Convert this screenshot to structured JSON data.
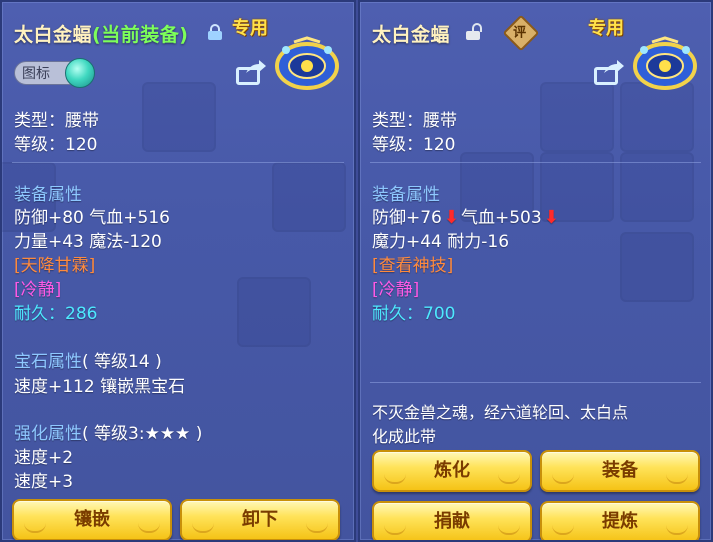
{
  "left": {
    "title_name": "太白金蝠",
    "title_status": "(当前装备)",
    "special_label": "专用",
    "toggle_label": "图标",
    "type_line": "类型：腰带",
    "level_line": "等级：120",
    "equip_attr_header": "装备属性",
    "stat_line_1": "防御+80 气血+516",
    "stat_line_2": "力量+43 魔法-120",
    "skill_tag": "[天降甘霖]",
    "effect_tag": "[冷静]",
    "durability_label": "耐久：",
    "durability_value": "286",
    "gem_header": "宝石属性",
    "gem_level": "( 等级14 )",
    "gem_line": "速度+112 镶嵌黑宝石",
    "enhance_header": "强化属性",
    "enhance_level": "( 等级3:★★★ )",
    "enhance_line_1": "速度+2",
    "enhance_line_2": "速度+3",
    "buttons": {
      "inlay": "镶嵌",
      "unequip": "卸下"
    }
  },
  "right": {
    "title_name": "太白金蝠",
    "rate_badge": "评",
    "special_label": "专用",
    "type_line": "类型：腰带",
    "level_line": "等级：120",
    "equip_attr_header": "装备属性",
    "stat_def": "防御+76",
    "stat_hp": "气血+503",
    "stat_line_2": "魔力+44 耐力-16",
    "skill_tag": "[查看神技]",
    "effect_tag": "[冷静]",
    "durability_label": "耐久：",
    "durability_value": "700",
    "desc_line_1": "不灭金兽之魂，经六道轮回、太白点",
    "desc_line_2": "化成此带",
    "buttons": {
      "refine": "炼化",
      "equip": "装备",
      "donate": "捐献",
      "extract": "提炼"
    }
  },
  "colors": {
    "panel_bg": "#4759a8",
    "section_header": "#8ec8ff",
    "current_equip": "#7dff5a",
    "skill_orange": "#ff8a3d",
    "effect_purple": "#ff5ae6",
    "durability_cyan": "#4ee9ff",
    "button_gold": "#ffe35a",
    "stat_down": "#ff2a2a"
  },
  "icons": [
    "lock-icon",
    "unlock-icon",
    "share-icon",
    "belt-item-icon",
    "rate-badge-icon",
    "down-arrow-icon"
  ]
}
